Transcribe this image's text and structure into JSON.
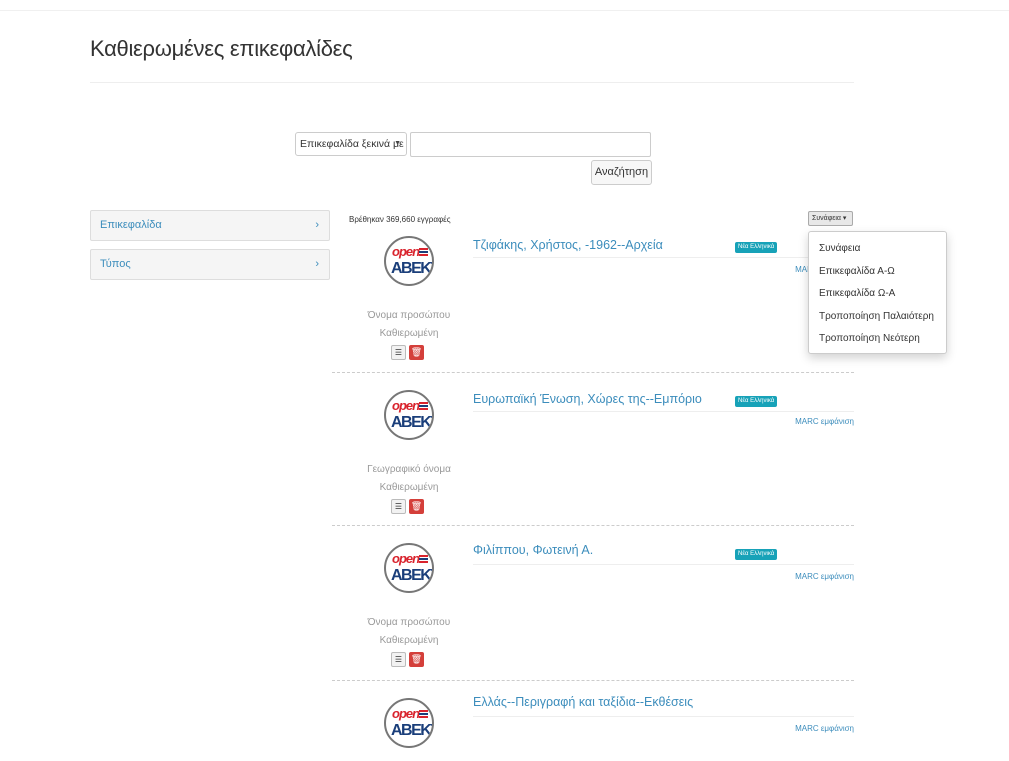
{
  "page": {
    "title": "Καθιερωμένες επικεφαλίδες"
  },
  "search": {
    "select_value": "Επικεφαλίδα ξεκινά με",
    "input_value": "",
    "button_label": "Αναζήτηση"
  },
  "facets": [
    {
      "label": "Επικεφαλίδα"
    },
    {
      "label": "Τύπος"
    }
  ],
  "results_count": "Βρέθηκαν 369,660 εγγραφές",
  "sort": {
    "button_label": "Συνάφεια",
    "options": [
      "Συνάφεια",
      "Επικεφαλίδα Α-Ω",
      "Επικεφαλίδα Ω-Α",
      "Τροποποίηση Παλαιότερη",
      "Τροποποίηση Νεότερη"
    ]
  },
  "logo": {
    "line1": "open",
    "line2": "ΑΒΕΚΤ",
    "colors": [
      "#d9232d",
      "#1a3e7a",
      "#777777"
    ]
  },
  "results": [
    {
      "title": "Τζιφάκης, Χρήστος, -1962--Αρχεία",
      "badge": "Νέα Ελληνικά",
      "marc": "MARC εμφάνιση",
      "type": "Όνομα προσώπου",
      "status": "Καθιερωμένη"
    },
    {
      "title": "Ευρωπαϊκή Ένωση, Χώρες της--Εμπόριο",
      "badge": "Νέα Ελληνικά",
      "marc": "MARC εμφάνιση",
      "type": "Γεωγραφικό όνομα",
      "status": "Καθιερωμένη"
    },
    {
      "title": "Φιλίππου, Φωτεινή Α.",
      "badge": "Νέα Ελληνικά",
      "marc": "MARC εμφάνιση",
      "type": "Όνομα προσώπου",
      "status": "Καθιερωμένη"
    },
    {
      "title": "Ελλάς--Περιγραφή και ταξίδια--Εκθέσεις",
      "badge": "",
      "marc": "MARC εμφάνιση",
      "type": "",
      "status": ""
    }
  ],
  "icons": {
    "list": "list-icon",
    "delete": "trash-icon",
    "chevron": "chevron-right-icon",
    "caret": "caret-down-icon"
  }
}
